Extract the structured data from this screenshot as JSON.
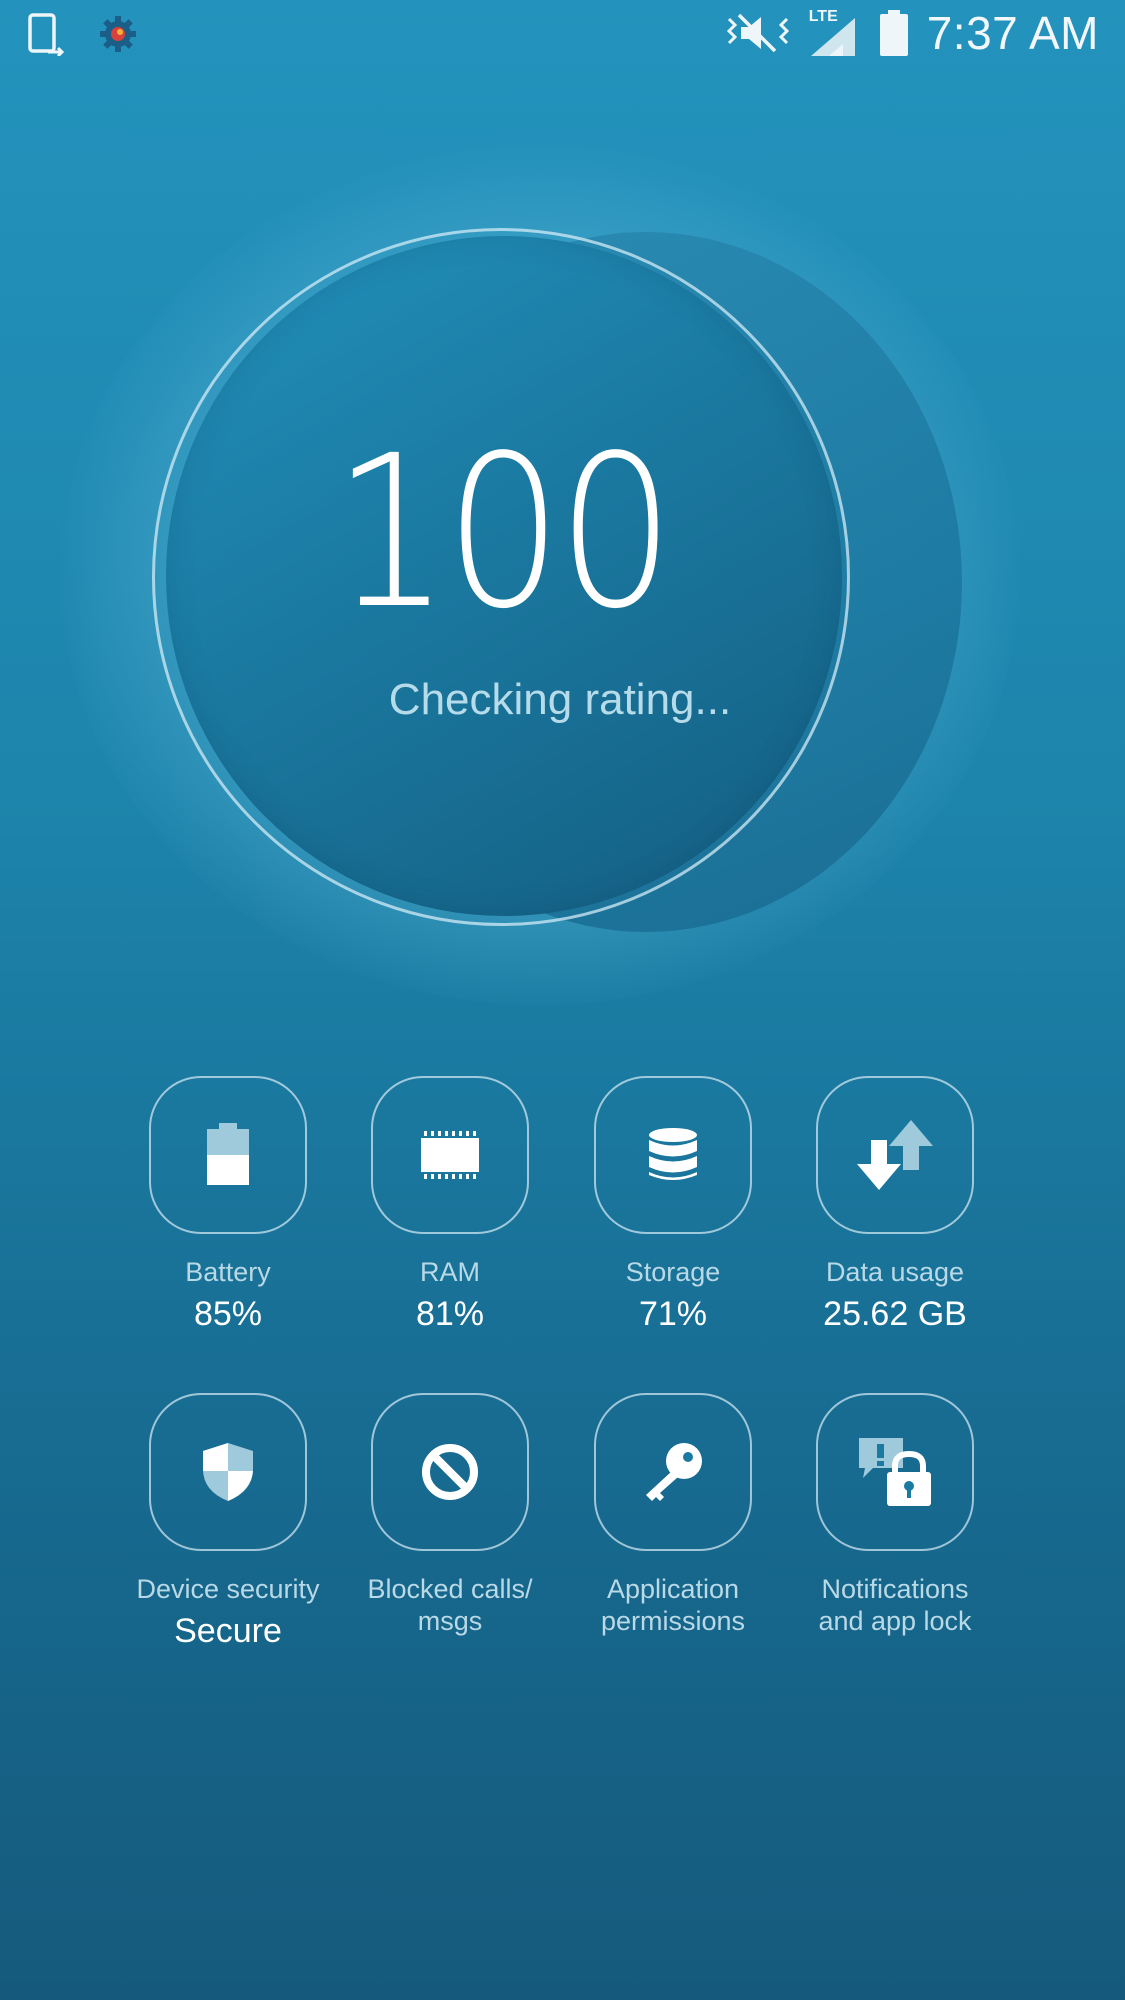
{
  "status_bar": {
    "time": "7:37 AM",
    "network": "LTE",
    "icons": [
      "device-update-icon",
      "settings-gear-icon",
      "mute-vibrate-icon",
      "signal-icon",
      "battery-icon"
    ]
  },
  "rating": {
    "score": "100",
    "status": "Checking rating..."
  },
  "tiles": [
    {
      "label": "Battery",
      "value": "85%",
      "icon": "battery-icon"
    },
    {
      "label": "RAM",
      "value": "81%",
      "icon": "ram-chip-icon"
    },
    {
      "label": "Storage",
      "value": "71%",
      "icon": "storage-database-icon"
    },
    {
      "label": "Data usage",
      "value": "25.62 GB",
      "icon": "data-transfer-icon"
    },
    {
      "label": "Device security",
      "value": "Secure",
      "icon": "shield-icon"
    },
    {
      "label": "Blocked calls/\nmsgs",
      "value": "",
      "icon": "block-icon"
    },
    {
      "label": "Application\npermissions",
      "value": "",
      "icon": "key-icon"
    },
    {
      "label": "Notifications\nand app lock",
      "value": "",
      "icon": "notification-lock-icon"
    }
  ],
  "colors": {
    "background_top": "#2393bd",
    "background_bottom": "#155a7c",
    "label": "#b9d9e6",
    "value": "#ffffff"
  }
}
